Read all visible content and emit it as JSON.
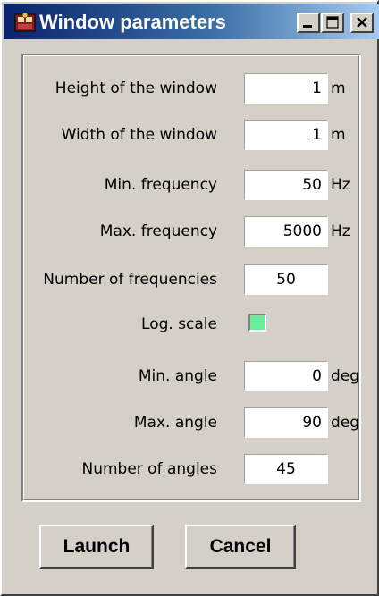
{
  "window": {
    "title": "Window parameters",
    "icon": "app-icon",
    "controls": {
      "minimize": "minimize-icon",
      "maximize": "maximize-icon",
      "close": "close-icon"
    }
  },
  "form": {
    "height": {
      "label": "Height of the window",
      "value": "1",
      "unit": "m"
    },
    "width": {
      "label": "Width of the window",
      "value": "1",
      "unit": "m"
    },
    "min_freq": {
      "label": "Min. frequency",
      "value": "50",
      "unit": "Hz"
    },
    "max_freq": {
      "label": "Max. frequency",
      "value": "5000",
      "unit": "Hz"
    },
    "num_freq": {
      "label": "Number of frequencies",
      "value": "50"
    },
    "log_scale": {
      "label": "Log. scale",
      "checked": true,
      "color": "#66ee99"
    },
    "min_angle": {
      "label": "Min. angle",
      "value": "0",
      "unit": "deg"
    },
    "max_angle": {
      "label": "Max. angle",
      "value": "90",
      "unit": "deg"
    },
    "num_angles": {
      "label": "Number of angles",
      "value": "45"
    }
  },
  "buttons": {
    "launch": "Launch",
    "cancel": "Cancel"
  },
  "colors": {
    "face": "#d4d0c8",
    "titlebar_start": "#0a246a",
    "titlebar_end": "#a6caf0"
  }
}
